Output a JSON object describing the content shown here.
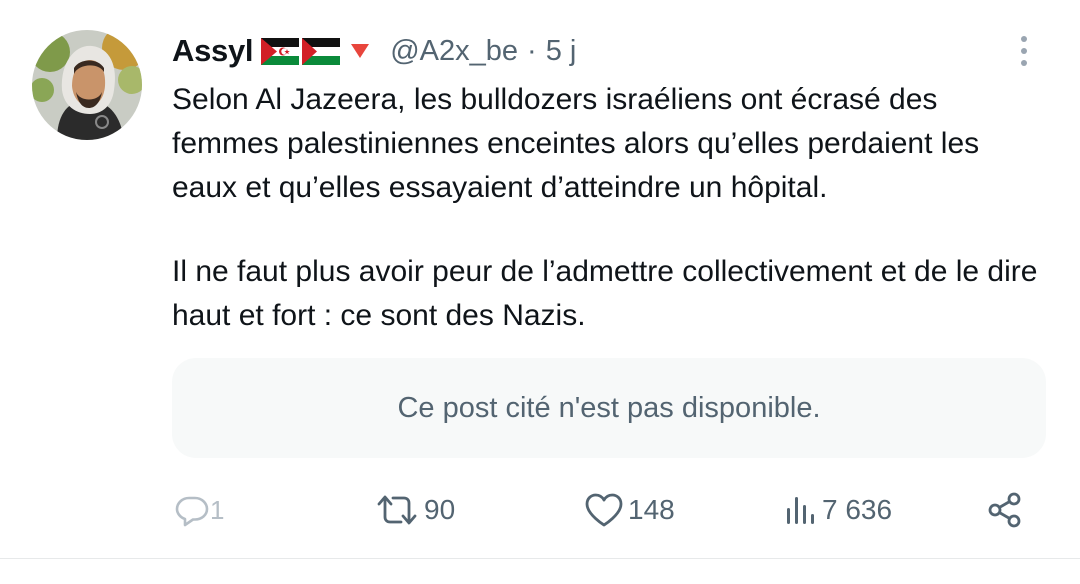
{
  "author": {
    "display_name": "Assyl",
    "handle": "@A2x_be",
    "separator": "·",
    "time_ago": "5 j",
    "flag_icons": [
      "western-sahara-flag-icon",
      "palestine-flag-icon"
    ],
    "badge_icon": "red-triangle-down-icon"
  },
  "post": {
    "paragraphs": [
      "Selon Al Jazeera, les bulldozers israéliens ont écrasé des femmes palestiniennes enceintes alors qu’elles perdaient les eaux et qu’elles essayaient d’atteindre un hôpital.",
      "Il ne faut plus avoir peur de l’admettre collectivement et de le dire haut et fort : ce sont des Nazis."
    ],
    "quote_unavailable": "Ce post cité n'est pas disponible."
  },
  "actions": {
    "replies": "1",
    "reposts": "90",
    "likes": "148",
    "views": "7 636"
  },
  "colors": {
    "text": "#0f1419",
    "secondary": "#536471",
    "quote_bg": "#f7f9f9",
    "divider": "#e7e9ea"
  }
}
